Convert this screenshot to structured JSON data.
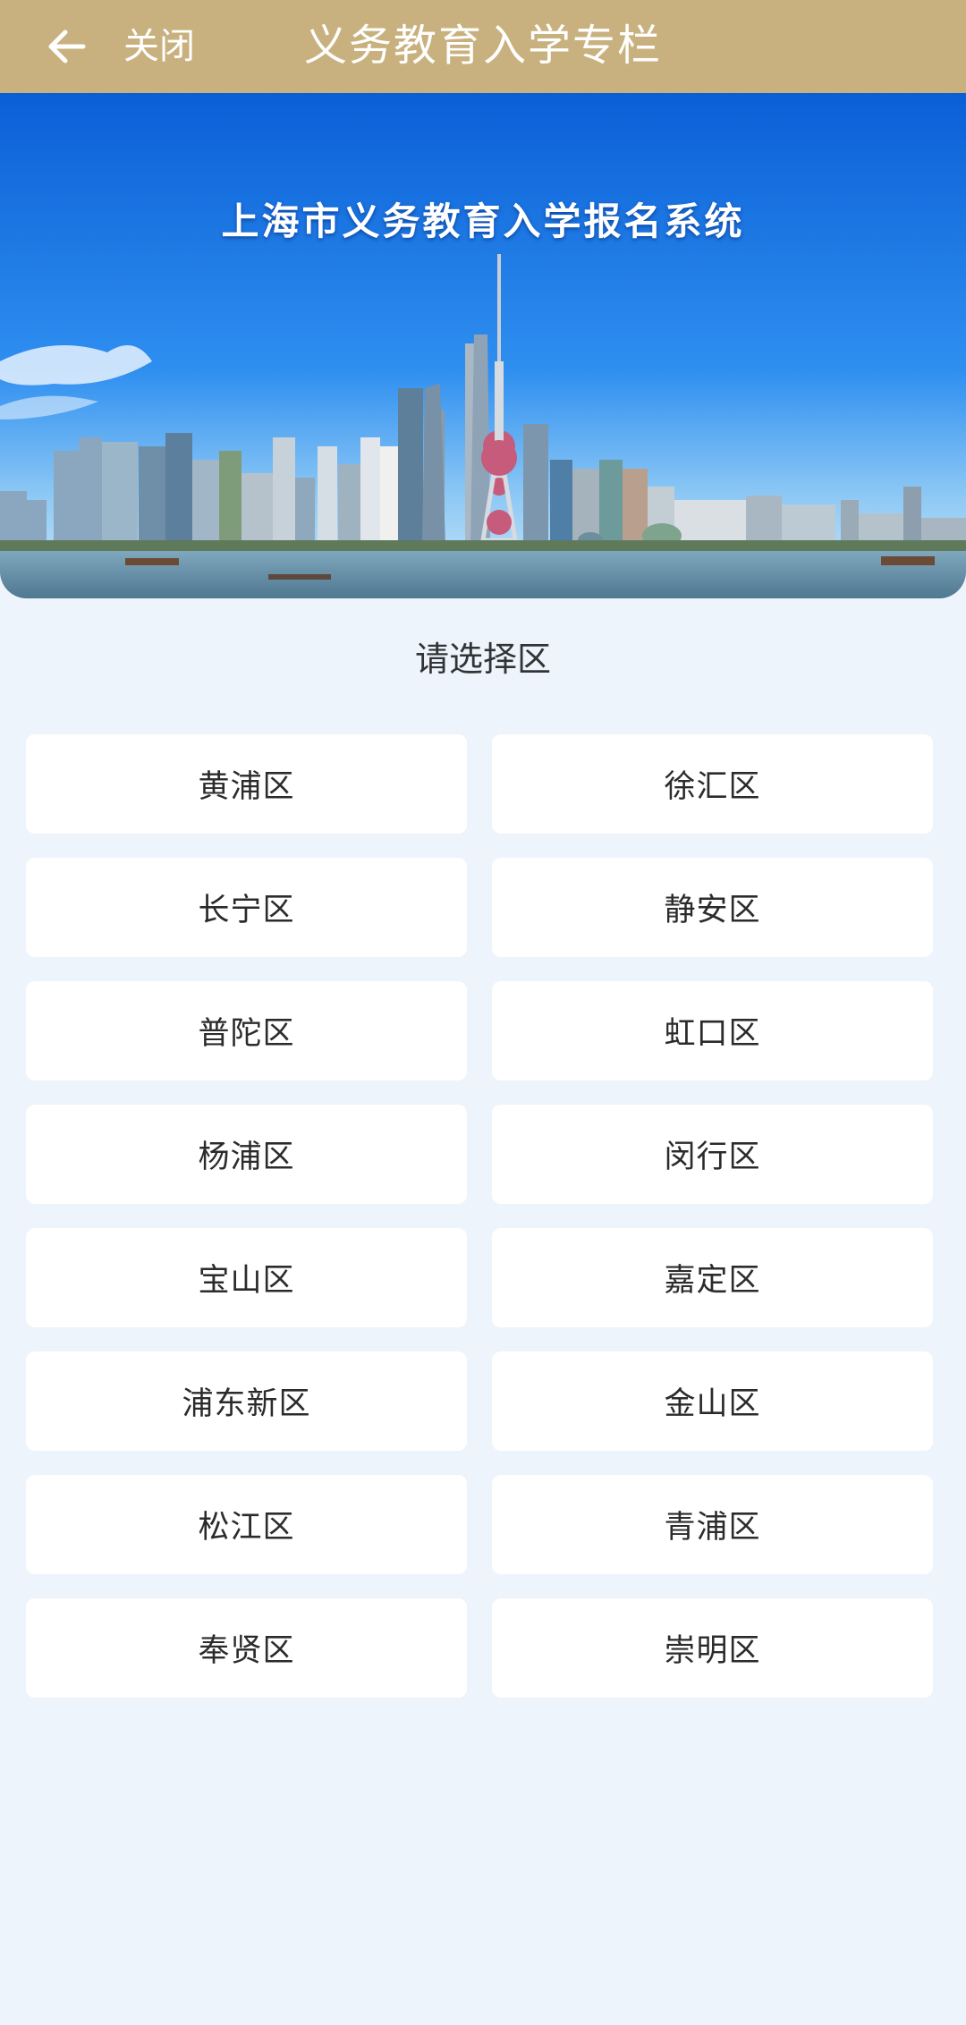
{
  "header": {
    "back_icon": "arrow-left-icon",
    "close_label": "关闭",
    "title": "义务教育入学专栏",
    "bg_color": "#c8b17e"
  },
  "banner": {
    "title": "上海市义务教育入学报名系统"
  },
  "prompt": "请选择区",
  "districts": [
    "黄浦区",
    "徐汇区",
    "长宁区",
    "静安区",
    "普陀区",
    "虹口区",
    "杨浦区",
    "闵行区",
    "宝山区",
    "嘉定区",
    "浦东新区",
    "金山区",
    "松江区",
    "青浦区",
    "奉贤区",
    "崇明区"
  ]
}
